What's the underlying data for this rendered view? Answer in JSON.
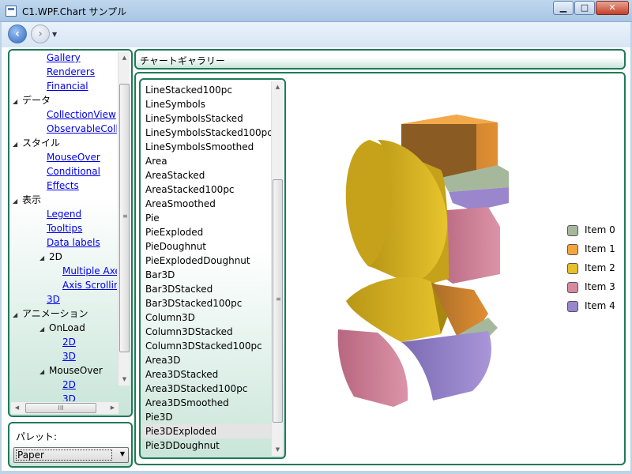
{
  "window": {
    "title": "C1.WPF.Chart サンプル"
  },
  "titlebar_buttons": [
    "▁",
    "□",
    "✕"
  ],
  "nav": {
    "back": "‹",
    "forward": "›",
    "dropdown": "▼"
  },
  "tree": {
    "items": [
      {
        "label": "Gallery",
        "link": true,
        "level": 2
      },
      {
        "label": "Renderers",
        "link": true,
        "level": 2
      },
      {
        "label": "Financial",
        "link": true,
        "level": 2
      },
      {
        "label": "データ",
        "link": false,
        "level": 1,
        "expanded": true
      },
      {
        "label": "CollectionView",
        "link": true,
        "level": 2
      },
      {
        "label": "ObservableColle",
        "link": true,
        "level": 2
      },
      {
        "label": "スタイル",
        "link": false,
        "level": 1,
        "expanded": true
      },
      {
        "label": "MouseOver",
        "link": true,
        "level": 2
      },
      {
        "label": "Conditional",
        "link": true,
        "level": 2
      },
      {
        "label": "Effects",
        "link": true,
        "level": 2
      },
      {
        "label": "表示",
        "link": false,
        "level": 1,
        "expanded": true
      },
      {
        "label": "Legend",
        "link": true,
        "level": 2
      },
      {
        "label": "Tooltips",
        "link": true,
        "level": 2
      },
      {
        "label": "Data labels",
        "link": true,
        "level": 2
      },
      {
        "label": "2D",
        "link": false,
        "level": 2,
        "expanded": true
      },
      {
        "label": "Multiple Axe",
        "link": true,
        "level": 3
      },
      {
        "label": "Axis Scrollin",
        "link": true,
        "level": 3
      },
      {
        "label": "3D",
        "link": true,
        "level": 2
      },
      {
        "label": "アニメーション",
        "link": false,
        "level": 1,
        "expanded": true
      },
      {
        "label": "OnLoad",
        "link": false,
        "level": 2,
        "expanded": true
      },
      {
        "label": "2D",
        "link": true,
        "level": 3
      },
      {
        "label": "3D",
        "link": true,
        "level": 3
      },
      {
        "label": "MouseOver",
        "link": false,
        "level": 2,
        "expanded": true
      },
      {
        "label": "2D",
        "link": true,
        "level": 3
      },
      {
        "label": "3D",
        "link": true,
        "level": 3
      }
    ],
    "expand_glyph": "◢",
    "hscroll_grip": "III",
    "vscroll_grip": "≡"
  },
  "palette": {
    "label": "パレット:",
    "value": "Paper",
    "arrow": "▼"
  },
  "header": {
    "title": "チャートギャラリー"
  },
  "chart_types": {
    "items": [
      "LineStacked100pc",
      "LineSymbols",
      "LineSymbolsStacked",
      "LineSymbolsStacked100pc",
      "LineSymbolsSmoothed",
      "Area",
      "AreaStacked",
      "AreaStacked100pc",
      "AreaSmoothed",
      "Pie",
      "PieExploded",
      "PieDoughnut",
      "PieExplodedDoughnut",
      "Bar3D",
      "Bar3DStacked",
      "Bar3DStacked100pc",
      "Column3D",
      "Column3DStacked",
      "Column3DStacked100pc",
      "Area3D",
      "Area3DStacked",
      "Area3DStacked100pc",
      "Area3DSmoothed",
      "Pie3D",
      "Pie3DExploded",
      "Pie3DDoughnut"
    ],
    "selected": "Pie3DExploded"
  },
  "chart_data": {
    "type": "pie",
    "variant": "Pie3DExploded",
    "legend_position": "right",
    "series": [
      {
        "name": "Item 0",
        "color": "#a6b89c"
      },
      {
        "name": "Item 1",
        "color": "#f4a43c"
      },
      {
        "name": "Item 2",
        "color": "#e6bf2a"
      },
      {
        "name": "Item 3",
        "color": "#d68aa0"
      },
      {
        "name": "Item 4",
        "color": "#9a86cc"
      }
    ]
  },
  "colors": {
    "accent": "#1f7a57",
    "link": "#0000ee"
  }
}
